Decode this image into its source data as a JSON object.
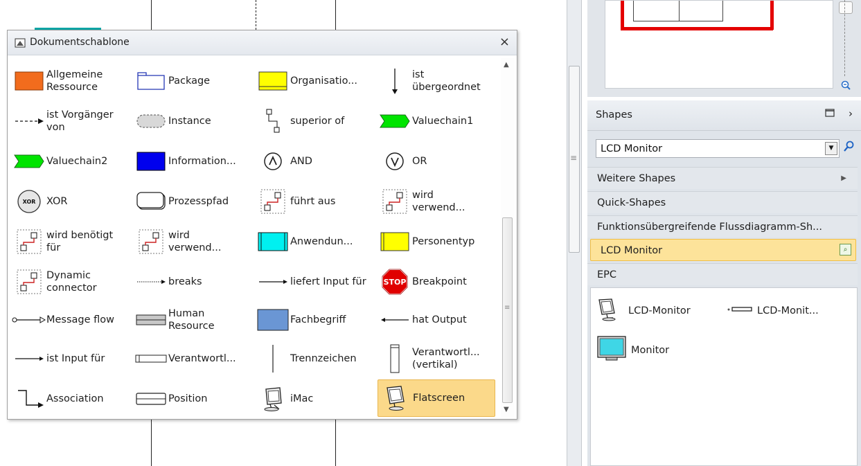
{
  "stencil": {
    "title": "Dokumentschablone",
    "close_label": "×",
    "items": [
      {
        "label": "Allgemeine Ressource",
        "icon": "orange-rectangle-icon"
      },
      {
        "label": "Package",
        "icon": "folder-icon"
      },
      {
        "label": "Organisatio...",
        "icon": "yellow-rectangle-icon"
      },
      {
        "label": "ist übergeordnet",
        "icon": "arrow-down-icon"
      },
      {
        "label": "ist Vorgänger von",
        "icon": "dashed-arrow-icon"
      },
      {
        "label": "Instance",
        "icon": "rounded-dashed-icon"
      },
      {
        "label": "superior of",
        "icon": "connector-icon"
      },
      {
        "label": "Valuechain1",
        "icon": "green-chevron-icon"
      },
      {
        "label": "Valuechain2",
        "icon": "green-chevron-icon"
      },
      {
        "label": "Information...",
        "icon": "blue-rectangle-icon"
      },
      {
        "label": "AND",
        "icon": "and-icon"
      },
      {
        "label": "OR",
        "icon": "or-icon"
      },
      {
        "label": "XOR",
        "icon": "xor-icon"
      },
      {
        "label": "Prozesspfad",
        "icon": "process-path-icon"
      },
      {
        "label": "führt aus",
        "icon": "dynamic-connector-icon"
      },
      {
        "label": "wird verwend...",
        "icon": "dynamic-connector-icon"
      },
      {
        "label": "wird benötigt für",
        "icon": "dynamic-connector-icon"
      },
      {
        "label": "wird verwend...",
        "icon": "dynamic-connector-icon"
      },
      {
        "label": "Anwendun...",
        "icon": "cyan-rectangle-icon"
      },
      {
        "label": "Personentyp",
        "icon": "yellow-rectangle-icon"
      },
      {
        "label": "Dynamic connector",
        "icon": "dynamic-connector-icon"
      },
      {
        "label": "breaks",
        "icon": "dotted-arrow-icon"
      },
      {
        "label": "liefert Input für",
        "icon": "arrow-right-icon"
      },
      {
        "label": "Breakpoint",
        "icon": "stop-sign-icon"
      },
      {
        "label": "Message flow",
        "icon": "message-flow-icon"
      },
      {
        "label": "Human Resource",
        "icon": "gray-bar-icon"
      },
      {
        "label": "Fachbegriff",
        "icon": "light-blue-rectangle-icon"
      },
      {
        "label": "hat Output",
        "icon": "line-left-icon"
      },
      {
        "label": "ist Input für",
        "icon": "arrow-right-icon"
      },
      {
        "label": "Verantwortl...",
        "icon": "horizontal-swimlane-icon"
      },
      {
        "label": "Trennzeichen",
        "icon": "vertical-line-icon"
      },
      {
        "label": "Verantwortl... (vertikal)",
        "icon": "vertical-swimlane-icon"
      },
      {
        "label": "Association",
        "icon": "association-icon"
      },
      {
        "label": "Position",
        "icon": "position-icon"
      },
      {
        "label": "iMac",
        "icon": "imac-icon"
      },
      {
        "label": "Flatscreen",
        "icon": "flatscreen-icon"
      }
    ]
  },
  "shapes_panel": {
    "title": "Shapes",
    "search_value": "LCD Monitor",
    "sections": [
      {
        "label": "Weitere Shapes",
        "has_arrow": true
      },
      {
        "label": "Quick-Shapes"
      },
      {
        "label": "Funktionsübergreifende Flussdiagramm-Sh..."
      },
      {
        "label": "LCD Monitor",
        "active": true
      },
      {
        "label": "EPC"
      }
    ],
    "shape_items": [
      {
        "label": "LCD-Monitor",
        "icon": "lcd-monitor-icon"
      },
      {
        "label": "LCD-Monit...",
        "icon": "lcd-monitor-flat-icon"
      },
      {
        "label": "Monitor",
        "icon": "monitor-icon"
      }
    ]
  },
  "colors": {
    "selection": "#fbd98a",
    "accent_blue": "#1c62c4",
    "red_frame": "#e40000"
  }
}
